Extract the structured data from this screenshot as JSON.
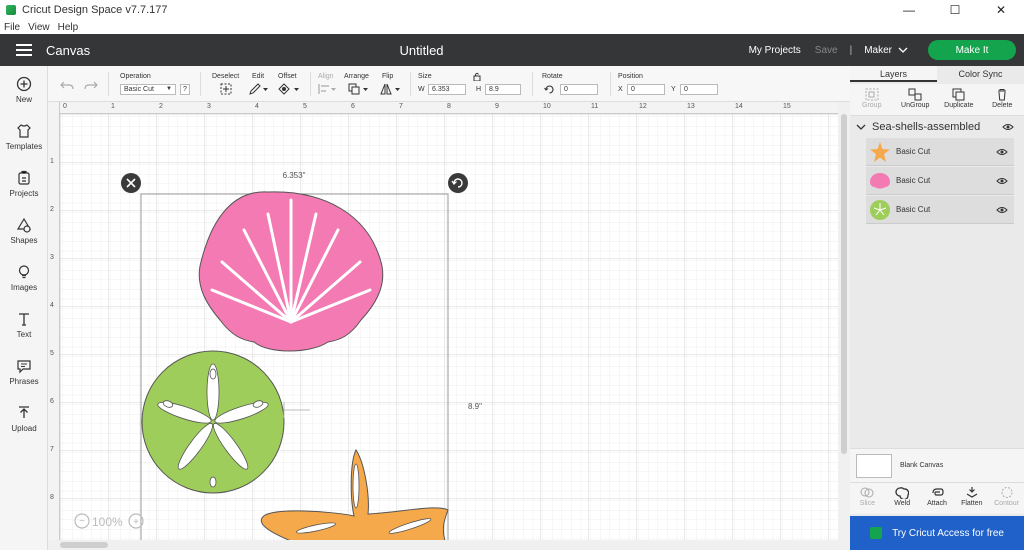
{
  "window": {
    "title": "Cricut Design Space  v7.7.177",
    "minimize": "—",
    "maximize": "☐",
    "close": "✕"
  },
  "menu": [
    "File",
    "View",
    "Help"
  ],
  "header": {
    "canvas_label": "Canvas",
    "doc_title": "Untitled",
    "my_projects": "My Projects",
    "save": "Save",
    "separator": "|",
    "machine": "Maker",
    "make_it": "Make It"
  },
  "left_nav": [
    {
      "label": "New",
      "icon": "plus-circle-icon"
    },
    {
      "label": "Templates",
      "icon": "shirt-icon"
    },
    {
      "label": "Projects",
      "icon": "projects-icon"
    },
    {
      "label": "Shapes",
      "icon": "shapes-icon"
    },
    {
      "label": "Images",
      "icon": "lightbulb-icon"
    },
    {
      "label": "Text",
      "icon": "text-icon"
    },
    {
      "label": "Phrases",
      "icon": "speech-bubble-icon"
    },
    {
      "label": "Upload",
      "icon": "upload-icon"
    }
  ],
  "toolbar": {
    "operation_label": "Operation",
    "operation_value": "Basic Cut",
    "operation_help": "?",
    "deselect_label": "Deselect",
    "edit_label": "Edit",
    "offset_label": "Offset",
    "align_label": "Align",
    "arrange_label": "Arrange",
    "flip_label": "Flip",
    "size_label": "Size",
    "w_label": "W",
    "w_value": "6.353",
    "h_label": "H",
    "h_value": "8.9",
    "rotate_label": "Rotate",
    "rotate_value": "0",
    "position_label": "Position",
    "x_label": "X",
    "x_value": "0",
    "y_label": "Y",
    "y_value": "0"
  },
  "canvas": {
    "ruler_top": [
      "0",
      "1",
      "2",
      "3",
      "4",
      "5",
      "6",
      "7",
      "8",
      "9",
      "10",
      "11",
      "12",
      "13",
      "14",
      "15"
    ],
    "ruler_left": [
      "1",
      "2",
      "3",
      "4",
      "5",
      "6",
      "7",
      "8"
    ],
    "width_readout": "6.353\"",
    "height_readout": "8.9\"",
    "zoom": "100%",
    "zoom_out": "−",
    "zoom_in": "+"
  },
  "panel": {
    "tabs": [
      "Layers",
      "Color Sync"
    ],
    "tools": [
      {
        "label": "Group",
        "enabled": false
      },
      {
        "label": "UnGroup",
        "enabled": true
      },
      {
        "label": "Duplicate",
        "enabled": true
      },
      {
        "label": "Delete",
        "enabled": true
      }
    ],
    "group_name": "Sea-shells-assembled",
    "layers": [
      {
        "label": "Basic Cut",
        "color": "#f5a94a",
        "shape": "starfish"
      },
      {
        "label": "Basic Cut",
        "color": "#f47ab3",
        "shape": "shell"
      },
      {
        "label": "Basic Cut",
        "color": "#9fcd5c",
        "shape": "sand-dollar"
      }
    ],
    "blank_canvas": "Blank Canvas",
    "bottom_tools": [
      {
        "label": "Slice",
        "enabled": false
      },
      {
        "label": "Weld",
        "enabled": true
      },
      {
        "label": "Attach",
        "enabled": true
      },
      {
        "label": "Flatten",
        "enabled": true
      },
      {
        "label": "Contour",
        "enabled": false
      }
    ],
    "access_banner": "Try Cricut Access for free"
  },
  "colors": {
    "shell": "#f47ab3",
    "sand_dollar": "#9fcd5c",
    "starfish": "#f5a94a",
    "header": "#343637",
    "make_it": "#14a44d",
    "banner": "#1f61c9"
  }
}
